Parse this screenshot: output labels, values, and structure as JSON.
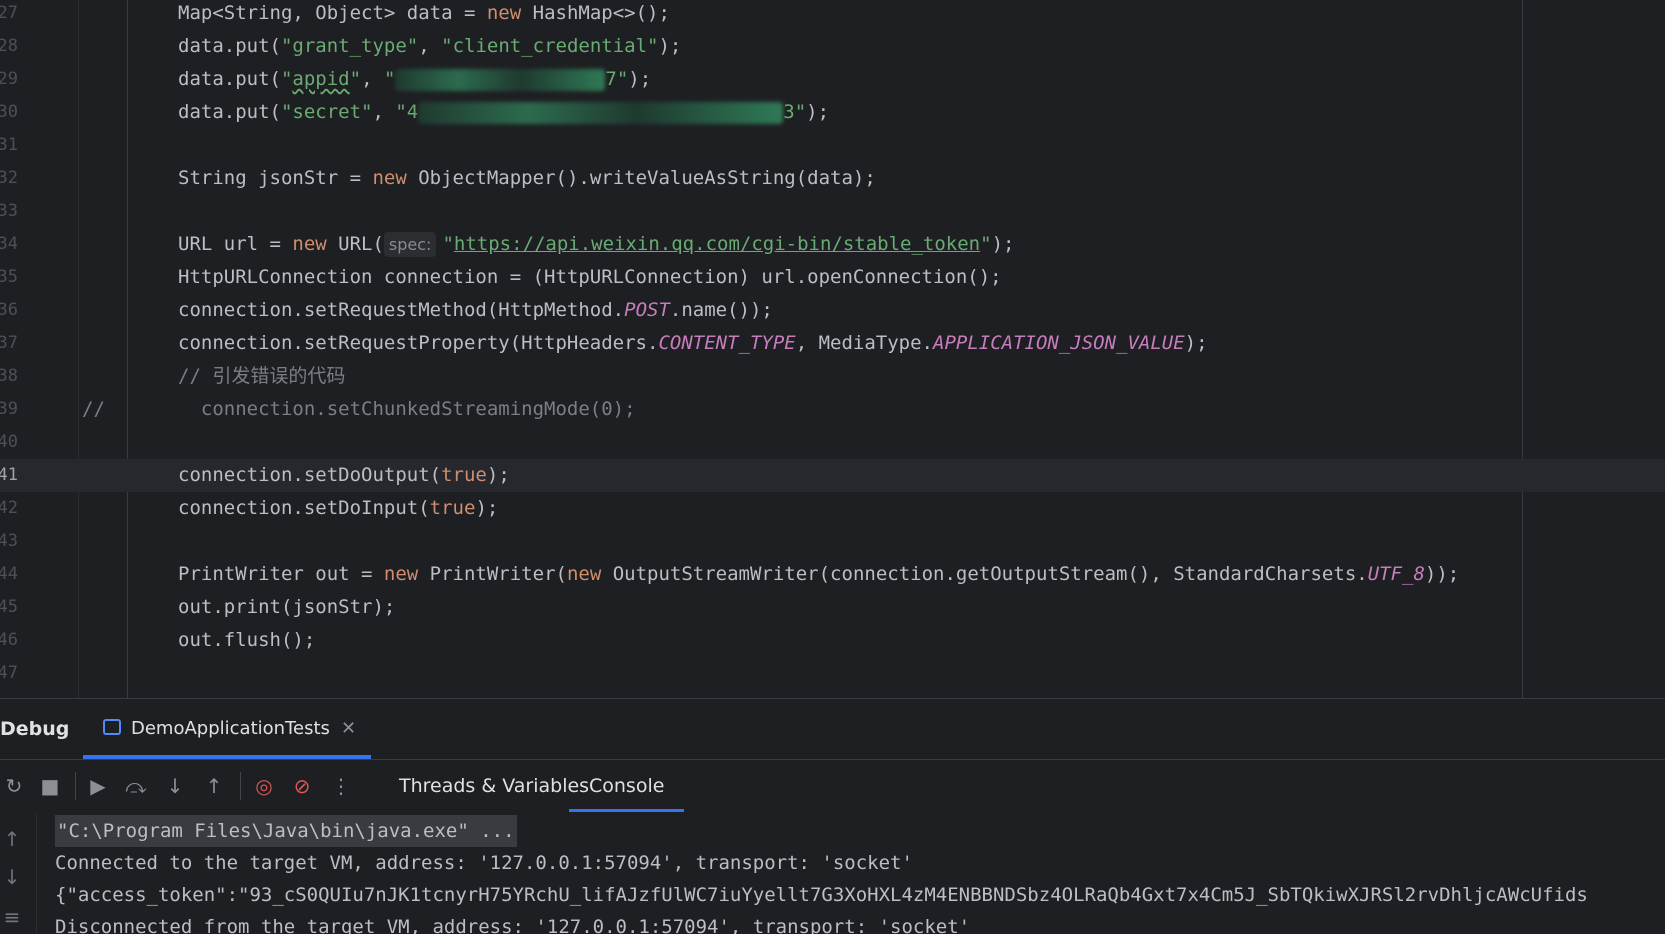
{
  "editor": {
    "line_numbers": [
      "27",
      "28",
      "29",
      "30",
      "31",
      "32",
      "33",
      "34",
      "35",
      "36",
      "37",
      "38",
      "39",
      "40",
      "41",
      "42",
      "43",
      "44",
      "45",
      "46",
      "47"
    ],
    "current_line_index": 14,
    "lines": [
      [
        {
          "t": "Map<String, Object> data = "
        },
        {
          "t": "new",
          "c": "kw"
        },
        {
          "t": " HashMap<>();"
        }
      ],
      [
        {
          "t": "data.put("
        },
        {
          "t": "\"grant_type\"",
          "c": "str"
        },
        {
          "t": ", "
        },
        {
          "t": "\"client_credential\"",
          "c": "str"
        },
        {
          "t": ");"
        }
      ],
      [
        {
          "t": "data.put("
        },
        {
          "t": "\"",
          "c": "str"
        },
        {
          "t": "appid",
          "c": "str typo"
        },
        {
          "t": "\"",
          "c": "str"
        },
        {
          "t": ", "
        },
        {
          "t": "\"",
          "c": "str"
        },
        {
          "r": 210
        },
        {
          "t": "7\"",
          "c": "str"
        },
        {
          "t": ");"
        }
      ],
      [
        {
          "t": "data.put("
        },
        {
          "t": "\"secret\"",
          "c": "str"
        },
        {
          "t": ", "
        },
        {
          "t": "\"4",
          "c": "str"
        },
        {
          "r": 365
        },
        {
          "t": "3\"",
          "c": "str"
        },
        {
          "t": ");"
        }
      ],
      [],
      [
        {
          "t": "String jsonStr = "
        },
        {
          "t": "new",
          "c": "kw"
        },
        {
          "t": " ObjectMapper().writeValueAsString(data);"
        }
      ],
      [],
      [
        {
          "t": "URL url = "
        },
        {
          "t": "new",
          "c": "kw"
        },
        {
          "t": " URL("
        },
        {
          "h": "spec:"
        },
        {
          "t": "\"",
          "c": "str"
        },
        {
          "t": "https://api.weixin.qq.com/cgi-bin/stable_token",
          "c": "url"
        },
        {
          "t": "\"",
          "c": "str"
        },
        {
          "t": ");"
        }
      ],
      [
        {
          "t": "HttpURLConnection connection = (HttpURLConnection) url.openConnection();"
        }
      ],
      [
        {
          "t": "connection.setRequestMethod(HttpMethod."
        },
        {
          "t": "POST",
          "c": "cst"
        },
        {
          "t": ".name());"
        }
      ],
      [
        {
          "t": "connection.setRequestProperty(HttpHeaders."
        },
        {
          "t": "CONTENT_TYPE",
          "c": "cst"
        },
        {
          "t": ", MediaType."
        },
        {
          "t": "APPLICATION_JSON_VALUE",
          "c": "cst"
        },
        {
          "t": ");"
        }
      ],
      [
        {
          "t": "// 引发错误的代码",
          "c": "cmt"
        }
      ],
      {
        "commented": true,
        "prefix": "//",
        "text": "  connection.setChunkedStreamingMode(0);"
      },
      [],
      [
        {
          "t": "connection.setDoOutput("
        },
        {
          "t": "true",
          "c": "kw"
        },
        {
          "t": ");"
        }
      ],
      [
        {
          "t": "connection.setDoInput("
        },
        {
          "t": "true",
          "c": "kw"
        },
        {
          "t": ");"
        }
      ],
      [],
      [
        {
          "t": "PrintWriter out = "
        },
        {
          "t": "new",
          "c": "kw"
        },
        {
          "t": " PrintWriter("
        },
        {
          "t": "new",
          "c": "kw"
        },
        {
          "t": " OutputStreamWriter(connection.getOutputStream(), StandardCharsets."
        },
        {
          "t": "UTF_8",
          "c": "cst"
        },
        {
          "t": "));"
        }
      ],
      [
        {
          "t": "out.print(jsonStr);"
        }
      ],
      [
        {
          "t": "out.flush();"
        }
      ],
      []
    ]
  },
  "debug": {
    "title": "Debug",
    "session_tab": "DemoApplicationTests",
    "tabs": [
      "Threads & Variables",
      "Console"
    ],
    "active_tab": "Console",
    "console_lines": [
      "\"C:\\Program Files\\Java\\bin\\java.exe\" ...",
      "Connected to the target VM, address: '127.0.0.1:57094', transport: 'socket'",
      "{\"access_token\":\"93_cS0QUIu7nJK1tcnyrH75YRchU_lifAJzfUlWC7iuYyellt7G3XoHXL4zM4ENBBNDSbz4OLRaQb4Gxt7x4Cm5J_SbTQkiwXJRSl2rvDhljcAWcUfids",
      "Disconnected from the target VM, address: '127.0.0.1:57094', transport: 'socket'"
    ]
  }
}
